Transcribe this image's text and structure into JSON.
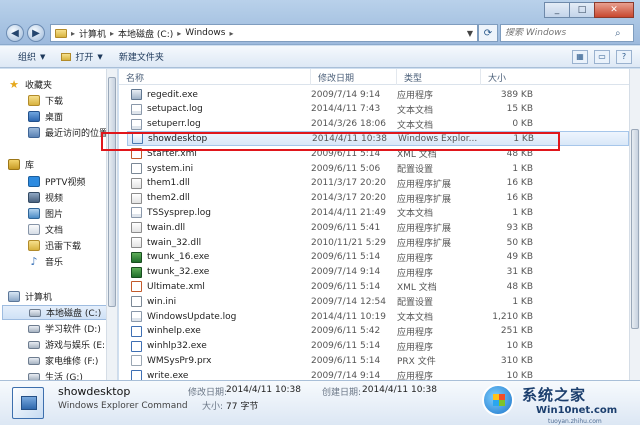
{
  "address": {
    "crumbs": [
      "计算机",
      "本地磁盘 (C:)",
      "Windows"
    ],
    "search_placeholder": "搜索 Windows"
  },
  "toolbar": {
    "organize": "组织",
    "open": "打开",
    "new_folder": "新建文件夹"
  },
  "navpane": {
    "favorites_label": "收藏夹",
    "favorites": [
      "下载",
      "桌面",
      "最近访问的位置"
    ],
    "libraries_label": "库",
    "libraries": [
      "PPTV视频",
      "视频",
      "图片",
      "文档",
      "迅雷下载",
      "音乐"
    ],
    "computer_label": "计算机",
    "drives": [
      "本地磁盘 (C:)",
      "学习软件 (D:)",
      "游戏与娱乐 (E:)",
      "家电维修 (F:)",
      "生活 (G:)"
    ]
  },
  "columns": {
    "name": "名称",
    "date": "修改日期",
    "type": "类型",
    "size": "大小"
  },
  "files": [
    {
      "name": "regedit.exe",
      "date": "2009/7/14 9:14",
      "type": "应用程序",
      "size": "389 KB",
      "icon": "exe"
    },
    {
      "name": "setupact.log",
      "date": "2014/4/11 7:43",
      "type": "文本文档",
      "size": "15 KB",
      "icon": "log"
    },
    {
      "name": "setuperr.log",
      "date": "2014/3/26 18:06",
      "type": "文本文档",
      "size": "0 KB",
      "icon": "log"
    },
    {
      "name": "showdesktop",
      "date": "2014/4/11 10:38",
      "type": "Windows Explor...",
      "size": "1 KB",
      "icon": "scf"
    },
    {
      "name": "Starter.xml",
      "date": "2009/6/11 5:14",
      "type": "XML 文档",
      "size": "48 KB",
      "icon": "xml"
    },
    {
      "name": "system.ini",
      "date": "2009/6/11 5:06",
      "type": "配置设置",
      "size": "1 KB",
      "icon": "ini"
    },
    {
      "name": "them1.dll",
      "date": "2011/3/17 20:20",
      "type": "应用程序扩展",
      "size": "16 KB",
      "icon": "dll"
    },
    {
      "name": "them2.dll",
      "date": "2014/3/17 20:20",
      "type": "应用程序扩展",
      "size": "16 KB",
      "icon": "dll"
    },
    {
      "name": "TSSysprep.log",
      "date": "2014/4/11 21:49",
      "type": "文本文档",
      "size": "1 KB",
      "icon": "log"
    },
    {
      "name": "twain.dll",
      "date": "2009/6/11 5:41",
      "type": "应用程序扩展",
      "size": "93 KB",
      "icon": "dll"
    },
    {
      "name": "twain_32.dll",
      "date": "2010/11/21 5:29",
      "type": "应用程序扩展",
      "size": "50 KB",
      "icon": "dll"
    },
    {
      "name": "twunk_16.exe",
      "date": "2009/6/11 5:14",
      "type": "应用程序",
      "size": "49 KB",
      "icon": "exe2"
    },
    {
      "name": "twunk_32.exe",
      "date": "2009/7/14 9:14",
      "type": "应用程序",
      "size": "31 KB",
      "icon": "exe2"
    },
    {
      "name": "Ultimate.xml",
      "date": "2009/6/11 5:14",
      "type": "XML 文档",
      "size": "48 KB",
      "icon": "xml"
    },
    {
      "name": "win.ini",
      "date": "2009/7/14 12:54",
      "type": "配置设置",
      "size": "1 KB",
      "icon": "ini"
    },
    {
      "name": "WindowsUpdate.log",
      "date": "2014/4/11 10:19",
      "type": "文本文档",
      "size": "1,210 KB",
      "icon": "log"
    },
    {
      "name": "winhelp.exe",
      "date": "2009/6/11 5:42",
      "type": "应用程序",
      "size": "251 KB",
      "icon": "exe3"
    },
    {
      "name": "winhlp32.exe",
      "date": "2009/6/11 5:14",
      "type": "应用程序",
      "size": "10 KB",
      "icon": "exe3"
    },
    {
      "name": "WMSysPr9.prx",
      "date": "2009/6/11 5:14",
      "type": "PRX 文件",
      "size": "310 KB",
      "icon": "prx"
    },
    {
      "name": "write.exe",
      "date": "2009/7/14 9:14",
      "type": "应用程序",
      "size": "10 KB",
      "icon": "exe3"
    }
  ],
  "details": {
    "name": "showdesktop",
    "kind": "Windows Explorer Command",
    "modified_label": "修改日期:",
    "modified_value": "2014/4/11 10:38",
    "created_label": "创建日期:",
    "created_value": "2014/4/11 10:38",
    "size_label": "大小:",
    "size_value": "77 字节"
  },
  "watermark": {
    "title": "系统之家",
    "sub": "Win10net.com",
    "url": "tuoyan.zhihu.com"
  }
}
